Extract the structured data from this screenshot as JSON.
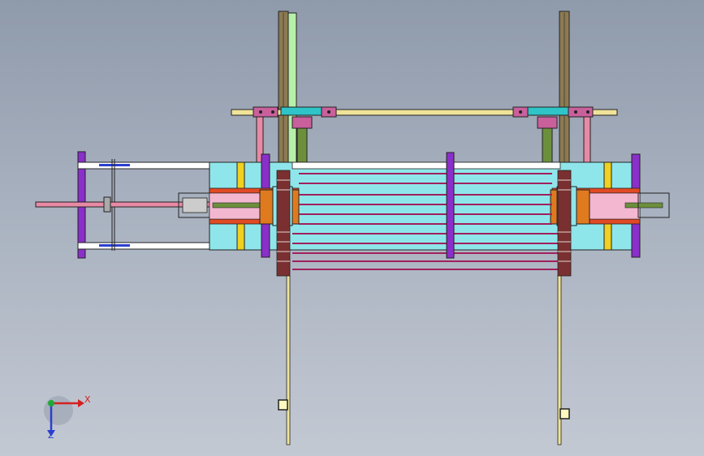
{
  "viewport": {
    "background_top": "#8f9aab",
    "background_bottom": "#c3c9d3"
  },
  "triad": {
    "x_label": "X",
    "z_label": "Z",
    "x_color": "#d42020",
    "y_color": "#1fa83a",
    "z_color": "#2a3fd0"
  },
  "colors": {
    "rail": "#efe39a",
    "pink": "#e88aa6",
    "magenta": "#c9609c",
    "cyan": "#8fe6ea",
    "cyan_dark": "#2fc4c8",
    "orange": "#e07a1f",
    "red": "#e24a24",
    "purple": "#8a2fc9",
    "green": "#6c8f3c",
    "olive": "#8c7a52",
    "lightgreen": "#b7f0a8",
    "lightpink": "#f3b7d0",
    "yellow": "#f0d020"
  }
}
